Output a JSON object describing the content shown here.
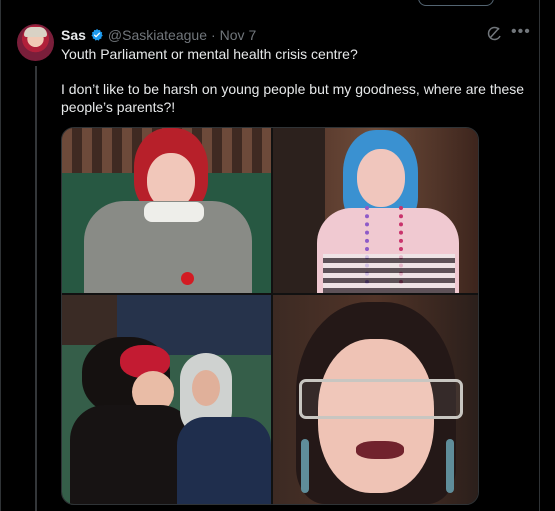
{
  "post": {
    "author_name": "Sas",
    "handle": "@Saskiateague",
    "separator": "·",
    "date": "Nov 7",
    "line1": "Youth Parliament or mental health crisis centre?",
    "line2": "I don’t like to be harsh on young people but my goodness, where are these people’s parents?!"
  },
  "icons": {
    "verified": "verified-badge-icon",
    "grok": "grok-icon",
    "more": "more-icon"
  },
  "colors": {
    "background": "#000000",
    "text": "#e7e9ea",
    "muted": "#71767b",
    "verified": "#1d9bf0",
    "border": "#2f3336"
  }
}
